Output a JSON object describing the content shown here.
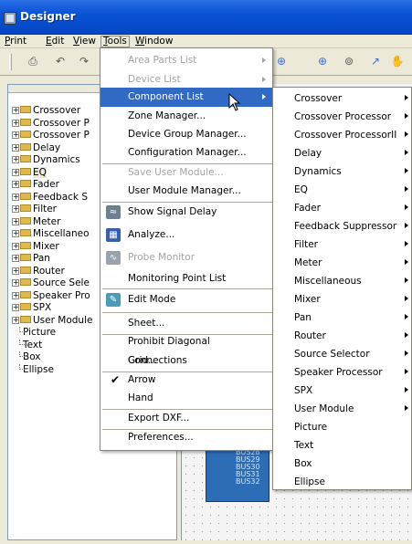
{
  "window": {
    "title": "Designer"
  },
  "menubar": {
    "items": [
      {
        "label": "Print",
        "underline": 0
      },
      {
        "label": "Edit",
        "underline": 0
      },
      {
        "label": "View",
        "underline": 0
      },
      {
        "label": "Tools",
        "underline": 0,
        "active": true
      },
      {
        "label": "Window",
        "underline": 0
      }
    ]
  },
  "tree": {
    "folders": [
      {
        "label": "Crossover"
      },
      {
        "label": "Crossover P"
      },
      {
        "label": "Crossover P"
      },
      {
        "label": "Delay"
      },
      {
        "label": "Dynamics"
      },
      {
        "label": "EQ",
        "selected": true
      },
      {
        "label": "Fader"
      },
      {
        "label": "Feedback S"
      },
      {
        "label": "Filter"
      },
      {
        "label": "Meter"
      },
      {
        "label": "Miscellaneo"
      },
      {
        "label": "Mixer"
      },
      {
        "label": "Pan"
      },
      {
        "label": "Router"
      },
      {
        "label": "Source Sele"
      },
      {
        "label": "Speaker Pro"
      },
      {
        "label": "SPX"
      },
      {
        "label": "User Module"
      }
    ],
    "leaves": [
      {
        "label": "Picture"
      },
      {
        "label": "Text"
      },
      {
        "label": "Box"
      },
      {
        "label": "Ellipse"
      }
    ]
  },
  "canvas": {
    "bus_labels": [
      "BUS28",
      "BUS29",
      "BUS30",
      "BUS31",
      "BUS32"
    ]
  },
  "tools_menu": {
    "items": [
      {
        "label": "Area Parts List",
        "disabled": true,
        "submenu": true
      },
      {
        "label": "Device List",
        "disabled": true,
        "submenu": true
      },
      {
        "label": "Component List",
        "highlight": true,
        "submenu": true
      },
      {
        "label": "Zone Manager..."
      },
      {
        "label": "Device Group Manager..."
      },
      {
        "label": "Configuration Manager..."
      },
      {
        "label": "Save User Module...",
        "disabled": true
      },
      {
        "label": "User Module Manager..."
      },
      {
        "label": "Show Signal Delay",
        "icon": "signal-delay-icon"
      },
      {
        "label": "Analyze...",
        "icon": "analyze-icon"
      },
      {
        "label": "Probe Monitor",
        "disabled": true,
        "icon": "probe-monitor-icon"
      },
      {
        "label": "Monitoring Point List"
      },
      {
        "label": "Edit Mode",
        "icon": "edit-mode-icon"
      },
      {
        "label": "Sheet..."
      },
      {
        "label": "Prohibit Diagonal Connections"
      },
      {
        "label": "Grid..."
      },
      {
        "label": "Arrow",
        "checked": true
      },
      {
        "label": "Hand"
      },
      {
        "label": "Export DXF..."
      },
      {
        "label": "Preferences..."
      }
    ]
  },
  "component_submenu": {
    "items": [
      {
        "label": "Crossover",
        "submenu": true
      },
      {
        "label": "Crossover Processor",
        "submenu": true
      },
      {
        "label": "Crossover ProcessorII",
        "submenu": true
      },
      {
        "label": "Delay",
        "submenu": true
      },
      {
        "label": "Dynamics",
        "submenu": true
      },
      {
        "label": "EQ",
        "submenu": true
      },
      {
        "label": "Fader",
        "submenu": true
      },
      {
        "label": "Feedback Suppressor",
        "submenu": true
      },
      {
        "label": "Filter",
        "submenu": true
      },
      {
        "label": "Meter",
        "submenu": true
      },
      {
        "label": "Miscellaneous",
        "submenu": true
      },
      {
        "label": "Mixer",
        "submenu": true
      },
      {
        "label": "Pan",
        "submenu": true
      },
      {
        "label": "Router",
        "submenu": true
      },
      {
        "label": "Source Selector",
        "submenu": true
      },
      {
        "label": "Speaker Processor",
        "submenu": true
      },
      {
        "label": "SPX",
        "submenu": true
      },
      {
        "label": "User Module",
        "submenu": true
      },
      {
        "label": "Picture"
      },
      {
        "label": "Text"
      },
      {
        "label": "Box"
      },
      {
        "label": "Ellipse"
      }
    ]
  },
  "colors": {
    "titlebar": "#0a53d6",
    "highlight": "#316ac5",
    "canvas_block": "#2d6db5"
  }
}
